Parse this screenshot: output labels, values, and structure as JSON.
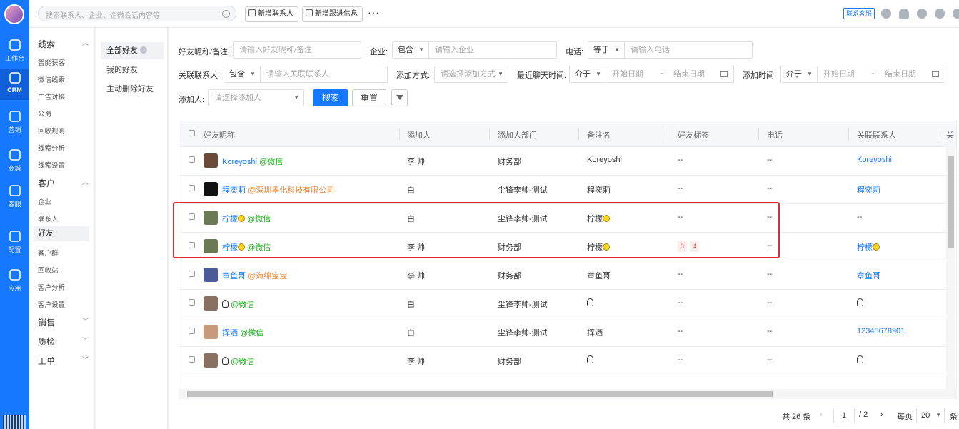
{
  "rail": [
    {
      "label": "工作台",
      "icon": "workbench-icon",
      "active": false
    },
    {
      "label": "CRM",
      "icon": "person-icon",
      "active": true
    },
    {
      "label": "营销",
      "icon": "bar-chart-icon",
      "active": false
    },
    {
      "label": "商城",
      "icon": "shop-icon",
      "active": false
    },
    {
      "label": "客服",
      "icon": "phone-icon",
      "active": false
    },
    {
      "label": "配置",
      "icon": "gear-icon",
      "active": false
    },
    {
      "label": "应用",
      "icon": "grid-icon",
      "active": false
    }
  ],
  "topbar": {
    "search_placeholder": "搜索联系人、企业、企微会话内容等",
    "btn_add_contact": "新增联系人",
    "btn_add_followup": "新增跟进信息",
    "more": "···",
    "kefu": "联系客服"
  },
  "sidebar": {
    "group_leads": "线索",
    "leads_items": [
      "智能获客",
      "微信线索",
      "广告对接",
      "公海",
      "回收规则",
      "线索分析",
      "线索设置"
    ],
    "group_customer": "客户",
    "customer_items": [
      "企业",
      "联系人",
      "好友",
      "客户群",
      "回收站",
      "客户分析",
      "客户设置"
    ],
    "group_sales": "销售",
    "group_quality": "质检",
    "group_ticket": "工单"
  },
  "subnav": [
    "全部好友",
    "我的好友",
    "主动删除好友"
  ],
  "filters": {
    "nick_label": "好友昵称/备注:",
    "nick_placeholder": "请输入好友昵称/备注",
    "corp_label": "企业:",
    "corp_op": "包含",
    "corp_placeholder": "请输入企业",
    "phone_label": "电话:",
    "phone_op": "等于",
    "phone_placeholder": "请输入电话",
    "rel_label": "关联联系人:",
    "rel_op": "包含",
    "rel_placeholder": "请输入关联联系人",
    "method_label": "添加方式:",
    "method_placeholder": "请选择添加方式",
    "chat_label": "最近聊天时间:",
    "chat_op": "介于",
    "start_ph": "开始日期",
    "tilde": "~",
    "end_ph": "结束日期",
    "addtime_label": "添加时间:",
    "addtime_op": "介于",
    "adder_label": "添加人:",
    "adder_placeholder": "请选择添加人",
    "search": "搜索",
    "reset": "重置"
  },
  "table": {
    "headers": [
      "好友昵称",
      "添加人",
      "添加人部门",
      "备注名",
      "好友标签",
      "电话",
      "关联联系人",
      "关"
    ],
    "rows": [
      {
        "nick": "Koreyoshi",
        "suffix": "@微信",
        "suffix_type": "wx",
        "adder": "李 帅",
        "dept": "财务部",
        "remark": "Koreyoshi",
        "tags": "--",
        "phone": "--",
        "rel": "Koreyoshi",
        "avatar": "#6b4a3a"
      },
      {
        "nick": "程奕莉",
        "suffix": "@深圳墨化科技有限公司",
        "suffix_type": "corp",
        "adder": "白",
        "dept": "尘锋李帅-测试",
        "remark": "程奕莉",
        "tags": "--",
        "phone": "--",
        "rel": "程奕莉",
        "avatar": "#111111"
      },
      {
        "nick": "柠檬",
        "suffix": "@微信",
        "suffix_type": "wx",
        "lemon": true,
        "adder": "白",
        "dept": "尘锋李帅-测试",
        "remark": "柠檬",
        "tags": "--",
        "phone": "--",
        "rel": "--",
        "avatar": "#6b7a55"
      },
      {
        "nick": "柠檬",
        "suffix": "@微信",
        "suffix_type": "wx",
        "lemon": true,
        "adder": "李 帅",
        "dept": "财务部",
        "remark": "柠檬",
        "tag_list": [
          "3",
          "4"
        ],
        "phone": "--",
        "rel": "柠檬",
        "avatar": "#6b7a55"
      },
      {
        "nick": "章鱼哥",
        "suffix": "@海绵宝宝",
        "suffix_type": "corp",
        "adder": "李 帅",
        "dept": "财务部",
        "remark": "章鱼哥",
        "tags": "--",
        "phone": "--",
        "rel": "章鱼哥",
        "avatar": "#4a5a9a"
      },
      {
        "nick": "",
        "suffix": "@微信",
        "suffix_type": "wx",
        "qq": true,
        "adder": "白",
        "dept": "尘锋李帅-测试",
        "remark": "",
        "tags": "--",
        "phone": "--",
        "rel": "",
        "avatar": "#8a7060"
      },
      {
        "nick": "挥洒",
        "suffix": "@微信",
        "suffix_type": "wx",
        "adder": "白",
        "dept": "尘锋李帅-测试",
        "remark": "挥洒",
        "tags": "--",
        "phone": "--",
        "rel": "12345678901",
        "avatar": "#c89a7a"
      },
      {
        "nick": "",
        "suffix": "@微信",
        "suffix_type": "wx",
        "qq": true,
        "adder": "李 帅",
        "dept": "财务部",
        "remark": "",
        "tags": "--",
        "phone": "--",
        "rel": "",
        "avatar": "#8a7060"
      }
    ]
  },
  "pager": {
    "total": "共 26 条",
    "page": "1",
    "of": "/ 2",
    "per_label": "每页",
    "per": "20",
    "unit": "条"
  },
  "colors": {
    "accent": "#1677ff",
    "highlight": "#e8282b"
  }
}
